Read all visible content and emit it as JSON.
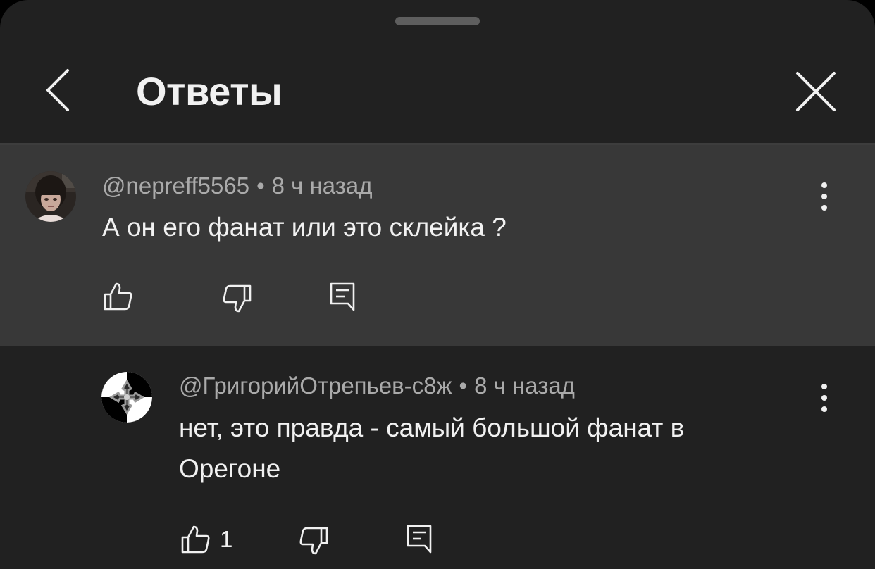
{
  "header": {
    "title": "Ответы",
    "back_icon": "chevron-left-icon",
    "close_icon": "close-icon"
  },
  "colors": {
    "sheet_background": "#212121",
    "highlighted_comment_background": "#383838",
    "primary_text": "#f1f1f1",
    "secondary_text": "#aaaaaa"
  },
  "comments": [
    {
      "author": "@nepreff5565",
      "separator": "•",
      "time": "8 ч назад",
      "text": "А он его фанат или это склейка ?",
      "likes": ""
    },
    {
      "author": "@ГригорийОтрепьев-с8ж",
      "separator": "•",
      "time": "8 ч назад",
      "text": "нет, это правда - самый большой фанат в Орегоне",
      "likes": "1"
    }
  ]
}
